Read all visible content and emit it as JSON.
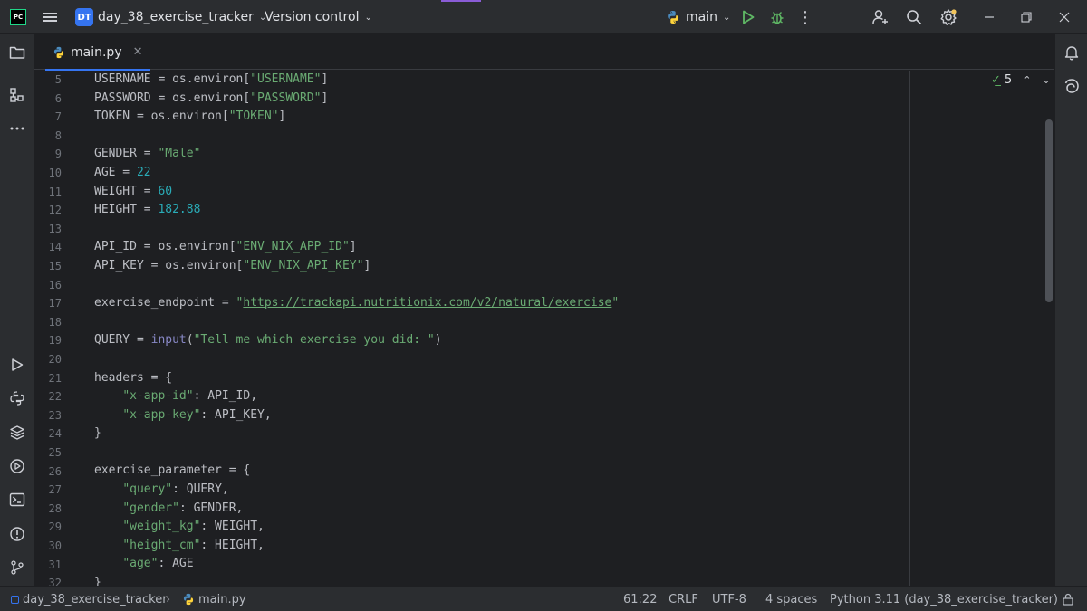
{
  "titlebar": {
    "logo_text": "PC",
    "project_badge": "DT",
    "project_name": "day_38_exercise_tracker",
    "vcs_label": "Version control",
    "branch": "main",
    "more_glyph": "⋮"
  },
  "tabs": [
    {
      "label": "main.py",
      "active": true
    }
  ],
  "editor": {
    "line_numbers": [
      "5",
      "6",
      "7",
      "8",
      "9",
      "10",
      "11",
      "12",
      "13",
      "14",
      "15",
      "16",
      "17",
      "18",
      "19",
      "20",
      "21",
      "22",
      "23",
      "24",
      "25",
      "26",
      "27",
      "28",
      "29",
      "30",
      "31",
      "32"
    ],
    "inspection_count": "5",
    "code_lines": [
      [
        {
          "t": "USERNAME = os.environ[",
          "c": ""
        },
        {
          "t": "\"USERNAME\"",
          "c": "s"
        },
        {
          "t": "]",
          "c": ""
        }
      ],
      [
        {
          "t": "PASSWORD = os.environ[",
          "c": ""
        },
        {
          "t": "\"PASSWORD\"",
          "c": "s"
        },
        {
          "t": "]",
          "c": ""
        }
      ],
      [
        {
          "t": "TOKEN = os.environ[",
          "c": ""
        },
        {
          "t": "\"TOKEN\"",
          "c": "s"
        },
        {
          "t": "]",
          "c": ""
        }
      ],
      [],
      [
        {
          "t": "GENDER = ",
          "c": ""
        },
        {
          "t": "\"Male\"",
          "c": "s"
        }
      ],
      [
        {
          "t": "AGE = ",
          "c": ""
        },
        {
          "t": "22",
          "c": "n"
        }
      ],
      [
        {
          "t": "WEIGHT = ",
          "c": ""
        },
        {
          "t": "60",
          "c": "n"
        }
      ],
      [
        {
          "t": "HEIGHT = ",
          "c": ""
        },
        {
          "t": "182.88",
          "c": "n"
        }
      ],
      [],
      [
        {
          "t": "API_ID = os.environ[",
          "c": ""
        },
        {
          "t": "\"ENV_NIX_APP_ID\"",
          "c": "s"
        },
        {
          "t": "]",
          "c": ""
        }
      ],
      [
        {
          "t": "API_KEY = os.environ[",
          "c": ""
        },
        {
          "t": "\"ENV_NIX_API_KEY\"",
          "c": "s"
        },
        {
          "t": "]",
          "c": ""
        }
      ],
      [],
      [
        {
          "t": "exercise_endpoint = ",
          "c": ""
        },
        {
          "t": "\"",
          "c": "s"
        },
        {
          "t": "https://trackapi.nutritionix.com/v2/natural/exercise",
          "c": "u"
        },
        {
          "t": "\"",
          "c": "s"
        }
      ],
      [],
      [
        {
          "t": "QUERY = ",
          "c": ""
        },
        {
          "t": "input",
          "c": "b"
        },
        {
          "t": "(",
          "c": ""
        },
        {
          "t": "\"Tell me which exercise you did: \"",
          "c": "s"
        },
        {
          "t": ")",
          "c": ""
        }
      ],
      [],
      [
        {
          "t": "headers = {",
          "c": ""
        }
      ],
      [
        {
          "t": "    ",
          "c": ""
        },
        {
          "t": "\"x-app-id\"",
          "c": "s"
        },
        {
          "t": ": API_ID,",
          "c": ""
        }
      ],
      [
        {
          "t": "    ",
          "c": ""
        },
        {
          "t": "\"x-app-key\"",
          "c": "s"
        },
        {
          "t": ": API_KEY,",
          "c": ""
        }
      ],
      [
        {
          "t": "}",
          "c": ""
        }
      ],
      [],
      [
        {
          "t": "exercise_parameter = {",
          "c": ""
        }
      ],
      [
        {
          "t": "    ",
          "c": ""
        },
        {
          "t": "\"query\"",
          "c": "s"
        },
        {
          "t": ": QUERY,",
          "c": ""
        }
      ],
      [
        {
          "t": "    ",
          "c": ""
        },
        {
          "t": "\"gender\"",
          "c": "s"
        },
        {
          "t": ": GENDER,",
          "c": ""
        }
      ],
      [
        {
          "t": "    ",
          "c": ""
        },
        {
          "t": "\"weight_kg\"",
          "c": "s"
        },
        {
          "t": ": WEIGHT,",
          "c": ""
        }
      ],
      [
        {
          "t": "    ",
          "c": ""
        },
        {
          "t": "\"height_cm\"",
          "c": "s"
        },
        {
          "t": ": HEIGHT,",
          "c": ""
        }
      ],
      [
        {
          "t": "    ",
          "c": ""
        },
        {
          "t": "\"age\"",
          "c": "s"
        },
        {
          "t": ": AGE",
          "c": ""
        }
      ],
      [
        {
          "t": "}",
          "c": ""
        }
      ]
    ]
  },
  "statusbar": {
    "project": "day_38_exercise_tracker",
    "separator": "›",
    "file": "main.py",
    "position": "61:22",
    "line_ending": "CRLF",
    "encoding": "UTF-8",
    "indent": "4 spaces",
    "interpreter": "Python 3.11 (day_38_exercise_tracker)"
  },
  "colors": {
    "background": "#1e1f22",
    "panel": "#2b2d30",
    "accent": "#3574f0",
    "string": "#6aab73",
    "number": "#2aacb8",
    "builtin": "#8888c6",
    "run": "#5fb865"
  }
}
